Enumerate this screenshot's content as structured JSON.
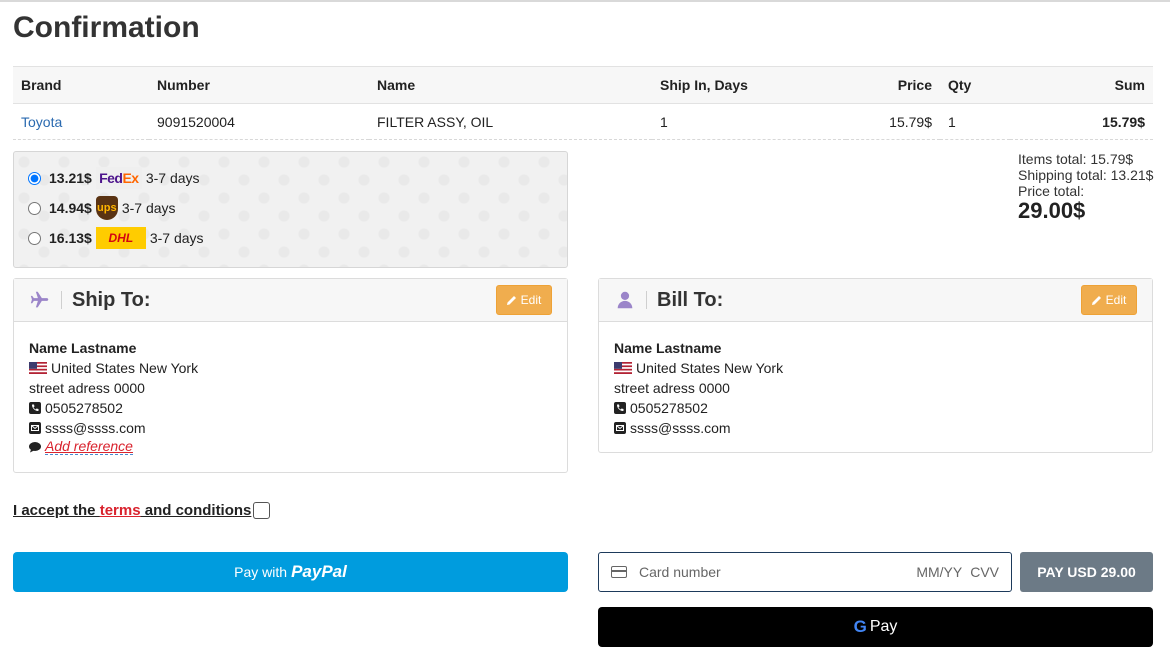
{
  "page": {
    "title": "Confirmation"
  },
  "table": {
    "headers": [
      "Brand",
      "Number",
      "Name",
      "Ship In, Days",
      "Price",
      "Qty",
      "Sum"
    ],
    "rows": [
      {
        "brand": "Toyota",
        "number": "9091520004",
        "name": "FILTER ASSY, OIL",
        "ship_days": "1",
        "price": "15.79$",
        "qty": "1",
        "sum": "15.79$"
      }
    ]
  },
  "shipping": {
    "options": [
      {
        "price": "13.21$",
        "carrier": "fedex-logo",
        "days": "3-7 days",
        "selected": true
      },
      {
        "price": "14.94$",
        "carrier": "ups-logo",
        "days": "3-7 days",
        "selected": false
      },
      {
        "price": "16.13$",
        "carrier": "dhl-logo",
        "days": "3-7 days",
        "selected": false
      }
    ]
  },
  "logos": {
    "fedex_fe": "Fed",
    "fedex_ex": "Ex",
    "ups": "ups",
    "dhl": "DHL"
  },
  "totals": {
    "items": "Items total: 15.79$",
    "shipping": "Shipping total: 13.21$",
    "price_label": "Price total:",
    "price": "29.00$"
  },
  "ship_to": {
    "title": "Ship To:",
    "edit_label": "Edit",
    "name": "Name Lastname",
    "location": "United States New York",
    "street": "street adress 0000",
    "phone": "0505278502",
    "email": "ssss@ssss.com",
    "reference": "Add reference"
  },
  "bill_to": {
    "title": "Bill To:",
    "edit_label": "Edit",
    "name": "Name Lastname",
    "location": "United States New York",
    "street": "street adress 0000",
    "phone": "0505278502",
    "email": "ssss@ssss.com"
  },
  "terms": {
    "prefix": "I accept the ",
    "link": "terms",
    "suffix": " and conditions"
  },
  "payment": {
    "paypal_prefix": "Pay with",
    "paypal_brand": "PayPal",
    "card_placeholder": "Card number",
    "expiry_placeholder": "MM/YY",
    "cvv_placeholder": "CVV",
    "pay_button": "PAY USD 29.00",
    "gpay_g": "G",
    "gpay_label": "Pay"
  },
  "colors": {
    "paypal": "#009cde",
    "edit": "#f0ad4e",
    "pay_button": "#6c7a86",
    "link": "#2a6ab0",
    "terms_link": "#d9232e",
    "icon_purple": "#9b85c9"
  }
}
